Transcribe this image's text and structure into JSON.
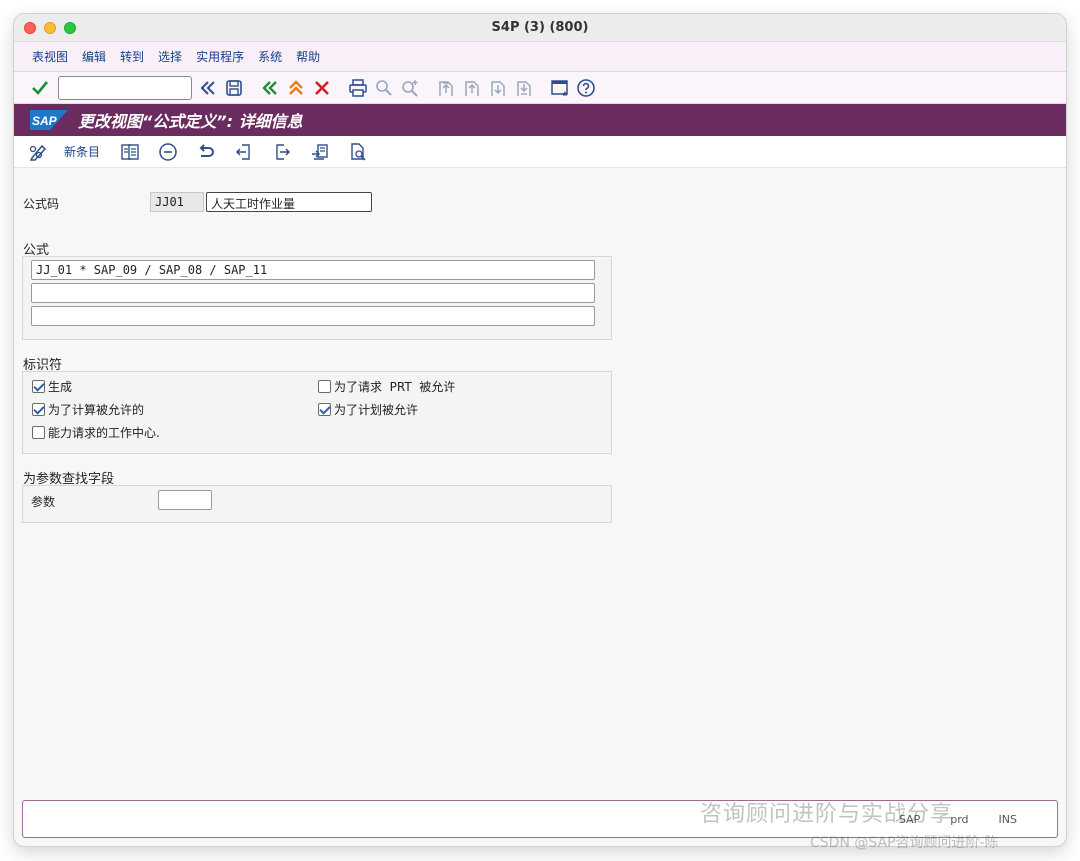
{
  "window": {
    "title": "S4P (3) (800)"
  },
  "menu": [
    "表视图",
    "编辑",
    "转到",
    "选择",
    "实用程序",
    "系统",
    "帮助"
  ],
  "toolbar": {
    "command_value": ""
  },
  "header": {
    "logo": "SAP",
    "title": "更改视图“公式定义”: 详细信息"
  },
  "app_toolbar": {
    "new_entries": "新条目"
  },
  "formula_key": {
    "label": "公式码",
    "code": "JJ01",
    "description": "人天工时作业量"
  },
  "formula": {
    "title": "公式",
    "lines": [
      "JJ_01 * SAP_09 / SAP_08 / SAP_11",
      "",
      ""
    ]
  },
  "indicators": {
    "title": "标识符",
    "items": [
      {
        "label": "生成",
        "checked": true
      },
      {
        "label": "为了请求  PRT  被允许",
        "checked": false
      },
      {
        "label": "为了计算被允许的",
        "checked": true
      },
      {
        "label": "为了计划被允许",
        "checked": true
      },
      {
        "label": "能力请求的工作中心.",
        "checked": false
      }
    ]
  },
  "param_search": {
    "title": "为参数查找字段",
    "label": "参数",
    "value": ""
  },
  "status": {
    "system": "SAP",
    "server": "prd",
    "mode": "INS"
  },
  "watermark": {
    "main": "咨询顾问进阶与实战分享",
    "sub": "CSDN @SAP咨询顾问进阶-陈"
  },
  "colors": {
    "header_bg": "#6a2b5e",
    "menu_text": "#1a3f8a",
    "check_green": "#1e8c3a",
    "cancel_red": "#d0202a",
    "nav_orange": "#e87d1e"
  }
}
